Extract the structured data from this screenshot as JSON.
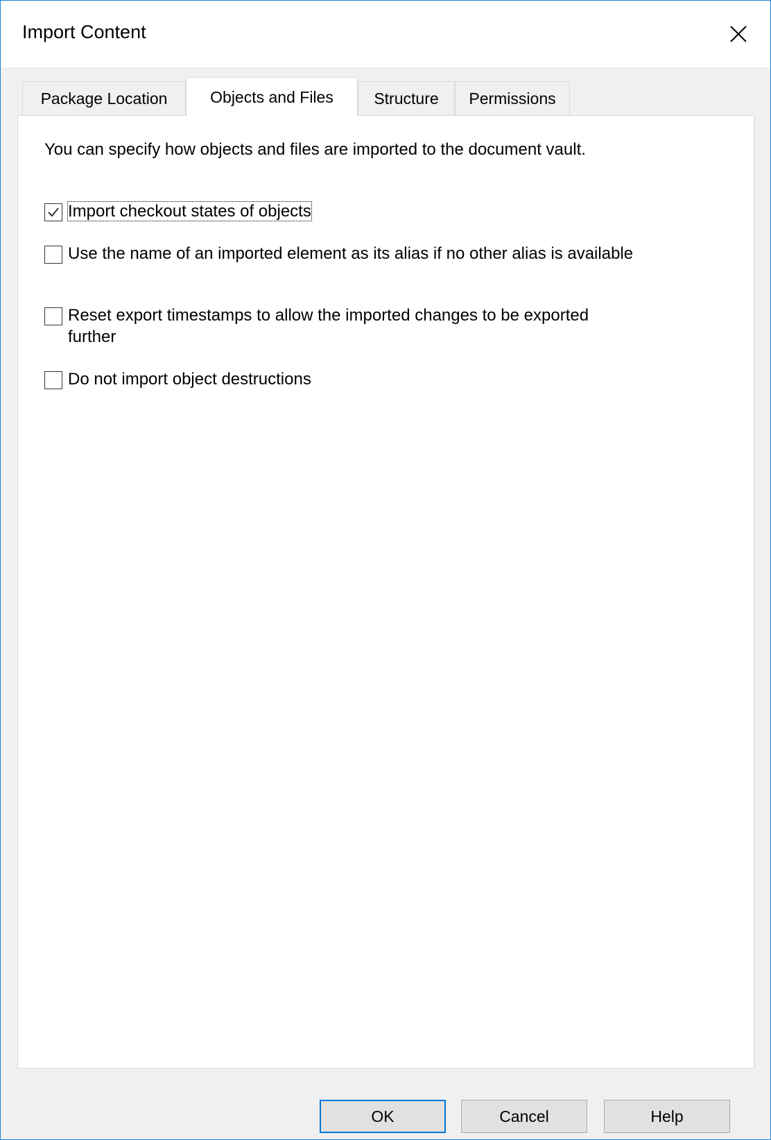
{
  "window": {
    "title": "Import Content"
  },
  "tabs": [
    {
      "label": "Package Location",
      "active": false
    },
    {
      "label": "Objects and Files",
      "active": true
    },
    {
      "label": "Structure",
      "active": false
    },
    {
      "label": "Permissions",
      "active": false
    }
  ],
  "panel": {
    "description": "You can specify how objects and files are imported to the document vault.",
    "options": [
      {
        "label": "Import checkout states of objects",
        "checked": true
      },
      {
        "label": "Use the name of an imported element as its alias if no other alias is available",
        "checked": false
      },
      {
        "label": "Reset export timestamps to allow the imported changes to be exported further",
        "checked": false
      },
      {
        "label": "Do not import object destructions",
        "checked": false
      }
    ]
  },
  "buttons": {
    "ok": "OK",
    "cancel": "Cancel",
    "help": "Help"
  },
  "icons": {
    "close": "close-icon",
    "check": "checkmark-icon"
  },
  "colors": {
    "accent": "#0078d7",
    "window_border": "#1a7fd4"
  }
}
